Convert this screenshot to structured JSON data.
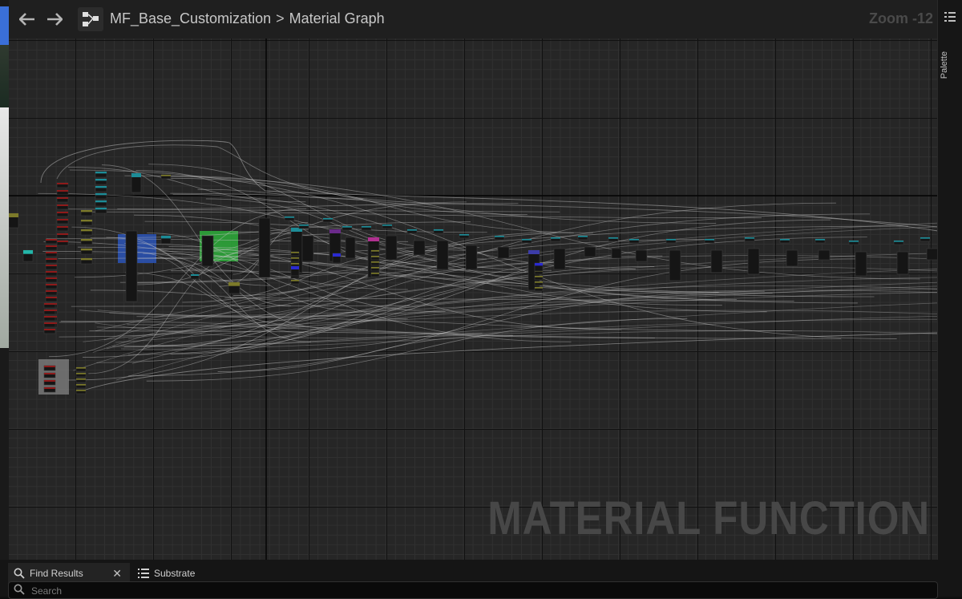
{
  "toolbar": {
    "back_glyph": "🡐",
    "forward_glyph": "🡒"
  },
  "breadcrumb": {
    "asset": "MF_Base_Customization",
    "separator": ">",
    "graph": "Material Graph"
  },
  "zoom_label": "Zoom -12",
  "watermark": "MATERIAL FUNCTION",
  "palette": {
    "label": "Palette"
  },
  "bottom_tabs": [
    {
      "label": "Find Results",
      "icon": "search-icon",
      "closable": true
    },
    {
      "label": "Substrate",
      "icon": "list-icon",
      "closable": false
    }
  ],
  "search": {
    "placeholder": "Search",
    "value": ""
  },
  "colors": {
    "graph_bg": "#262626",
    "wire": "#c8c8c8",
    "node_body": "#151515",
    "node_header_cyan": "#2aa7b0",
    "node_param_red": "#8e1a1a",
    "node_olive": "#7c7a2a",
    "comment_blue": "#2b55b8",
    "comment_green": "#2ea63a"
  }
}
